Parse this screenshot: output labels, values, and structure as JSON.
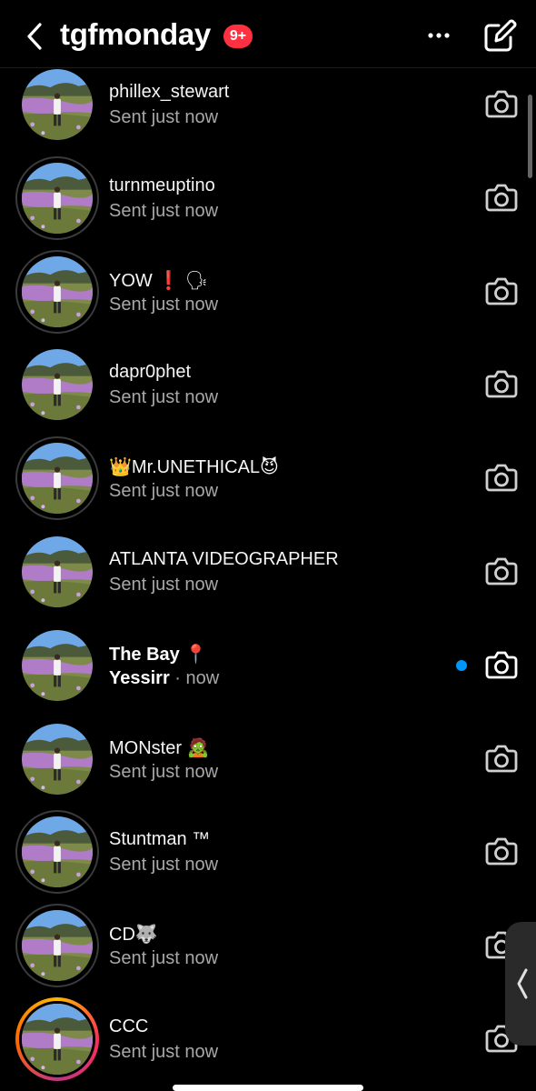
{
  "header": {
    "title": "tgfmonday",
    "badge": "9+"
  },
  "threads": [
    {
      "name": "phillex_stewart",
      "sub": "Sent just now",
      "avatar": "plain"
    },
    {
      "name": "turnmeuptino",
      "sub": "Sent just now",
      "avatar": "ring"
    },
    {
      "name": "YOW ❗ 🗣",
      "sub": "Sent just now",
      "avatar": "ring"
    },
    {
      "name": "dapr0phet",
      "sub": "Sent just now",
      "avatar": "plain"
    },
    {
      "name": "👑Mr.UNETHICAL😈",
      "sub": "Sent just now",
      "avatar": "ring"
    },
    {
      "name": "ATLANTA VIDEOGRAPHER",
      "sub": "Sent just now",
      "avatar": "plain"
    },
    {
      "name": "The Bay 📍",
      "sub_main": "Yessirr",
      "sub_time": " · now",
      "avatar": "plain",
      "unread": true
    },
    {
      "name": "MONster 🧟",
      "sub": "Sent just now",
      "avatar": "plain"
    },
    {
      "name": "Stuntman ™",
      "sub": "Sent just now",
      "avatar": "ring"
    },
    {
      "name": "CD🐺",
      "sub": "Sent just now",
      "avatar": "ring"
    },
    {
      "name": "CCC",
      "sub": "Sent just now",
      "avatar": "gradient"
    }
  ],
  "icons": {
    "back": "chevron-left-icon",
    "more": "more-horizontal-icon",
    "compose": "compose-icon",
    "camera": "camera-icon",
    "side_handle": "chevron-left-icon"
  },
  "colors": {
    "background": "#000000",
    "badge": "#ff3040",
    "unread_dot": "#0095f6",
    "secondary_text": "#a8a8a8"
  }
}
